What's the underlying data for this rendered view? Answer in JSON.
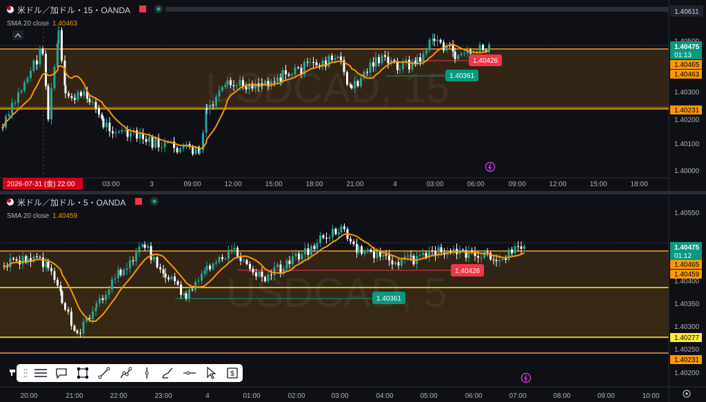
{
  "top": {
    "title": "米ドル／加ドル・15・OANDA",
    "sma_label": "SMA 20 close",
    "sma_value": "1.40463",
    "watermark": "USDCAD, 15",
    "current_price": "1.40475",
    "countdown": "01:13",
    "labels": [
      "1.40465",
      "1.40463",
      "1.40231"
    ],
    "dark_label": "1.40611",
    "red_badge": "1.40426",
    "green_badge": "1.40361",
    "date_badge": "2026-07-31 (金)   22:00",
    "y_ticks": [
      "1.40500",
      "1.40300",
      "1.40200",
      "1.40100",
      "1.40000"
    ],
    "x_ticks": [
      "03:00",
      "3",
      "09:00",
      "12:00",
      "15:00",
      "18:00",
      "21:00",
      "4",
      "03:00",
      "06:00",
      "09:00",
      "12:00",
      "15:00",
      "18:00"
    ]
  },
  "bottom": {
    "title": "米ドル／加ドル・5・OANDA",
    "sma_label": "SMA 20 close",
    "sma_value": "1.40459",
    "watermark": "USDCAD, 5",
    "current_price": "1.40475",
    "countdown": "01:12",
    "labels": [
      "1.40465",
      "1.40459"
    ],
    "yellow_label": "1.40277",
    "orange_label": "1.40231",
    "red_badge": "1.40426",
    "green_badge": "1.40361",
    "y_ticks": [
      "1.40550",
      "1.40400",
      "1.40350",
      "1.40300",
      "1.40250",
      "1.40200"
    ],
    "x_ticks": [
      "20:00",
      "21:00",
      "22:00",
      "23:00",
      "4",
      "01:00",
      "02:00",
      "03:00",
      "04:00",
      "05:00",
      "06:00",
      "07:00",
      "08:00",
      "09:00",
      "10:00"
    ]
  },
  "toolbar": {
    "tools": [
      "menu-lines-icon",
      "comment-icon",
      "rectangle-icon",
      "trendline-icon",
      "path-icon",
      "vertical-line-icon",
      "brush-icon",
      "horizontal-ray-icon",
      "cursor-icon",
      "price-label-icon"
    ]
  },
  "colors": {
    "bg": "#0f1016",
    "up": "#26a69a",
    "down": "#ffffff",
    "sma": "#ff9800",
    "zone": "#3b2a14",
    "zone_line": "#f7a21b",
    "yellow": "#ffeb3b",
    "red": "#f23645",
    "teal": "#089981"
  }
}
